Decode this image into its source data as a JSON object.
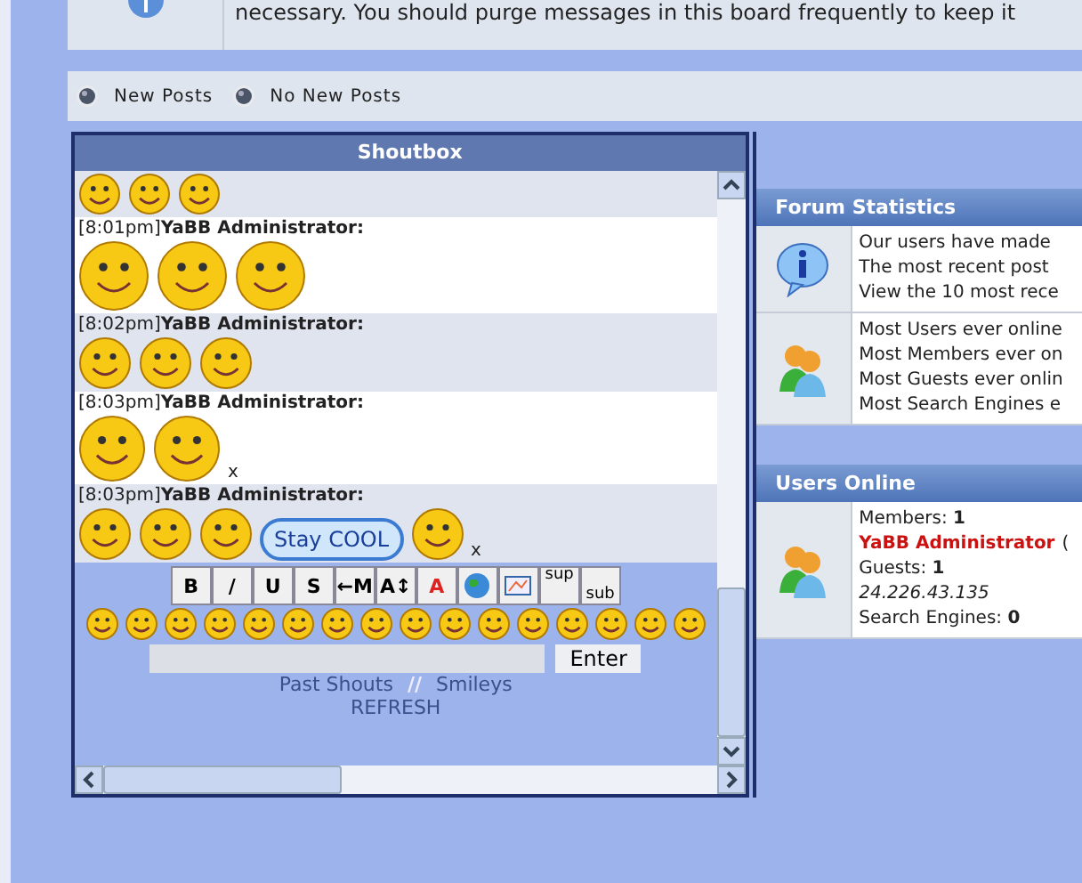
{
  "notice": {
    "text": "necessary. You should purge messages in this board frequently to keep it"
  },
  "legend": [
    {
      "label": "New Posts"
    },
    {
      "label": "No New Posts"
    }
  ],
  "shoutbox": {
    "title": "Shoutbox",
    "messages": [
      {
        "shaded": true
      },
      {
        "header": "[8:01pm]**YaBB Administrator:**",
        "shaded": false
      },
      {
        "header": "[8:02pm]**YaBB Administrator:**",
        "shaded": true
      },
      {
        "header": "[8:03pm]**YaBB Administrator:**",
        "shaded": false,
        "trailing": "x"
      },
      {
        "header": "[8:03pm]**YaBB Administrator:**",
        "shaded": true,
        "trailing": "x",
        "bubble": "Stay COOL"
      }
    ],
    "toolbar": [
      {
        "kind": "text",
        "label": "B"
      },
      {
        "kind": "text",
        "label": "/"
      },
      {
        "kind": "text",
        "label": "U"
      },
      {
        "kind": "text",
        "label": "S"
      },
      {
        "kind": "text",
        "label": "←M"
      },
      {
        "kind": "text",
        "label": "A↕"
      },
      {
        "kind": "color",
        "label": "A"
      },
      {
        "kind": "globe"
      },
      {
        "kind": "image"
      },
      {
        "kind": "sup",
        "label": "sup"
      },
      {
        "kind": "sub",
        "label": "sub"
      }
    ],
    "enter_button": "Enter",
    "links": [
      {
        "label": "Past Shouts"
      },
      {
        "label": "//"
      },
      {
        "label": "Smileys"
      }
    ],
    "refresh": "REFRESH"
  },
  "forum_statistics": {
    "title": "Forum Statistics",
    "groups": [
      {
        "kind": "info",
        "lines": [
          "Our users have made",
          "The most recent post",
          "View the 10 most rece"
        ]
      },
      {
        "kind": "users",
        "lines": [
          "Most Users ever online",
          "Most Members ever on",
          "Most Guests ever onlin",
          "Most Search Engines e"
        ]
      }
    ]
  },
  "users_online": {
    "title": "Users Online",
    "lines": [
      {
        "kind": "plain",
        "text": "Members: **1**"
      },
      {
        "kind": "member",
        "text": "YaBB Administrator",
        "suffix": "("
      },
      {
        "kind": "plain",
        "text": "Guests: **1**"
      },
      {
        "kind": "ip",
        "text": "24.226.43.135"
      },
      {
        "kind": "plain",
        "text": "Search Engines: **0**"
      }
    ]
  }
}
